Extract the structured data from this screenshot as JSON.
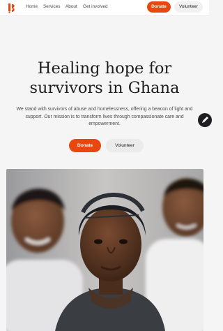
{
  "header": {
    "logo_icon": "organization-logo-icon",
    "nav": [
      "Home",
      "Services",
      "About",
      "Get involved"
    ],
    "donate_label": "Donate",
    "volunteer_label": "Volunteer"
  },
  "hero": {
    "title_line1": "Healing hope for",
    "title_line2": "survivors in Ghana",
    "description": "We stand with survivors of abuse and homelessness, offering a beacon of light and support. Our mission is to transform lives through compassionate care and empowerment.",
    "donate_label": "Donate",
    "volunteer_label": "Volunteer"
  },
  "edit_icon": "pencil-icon",
  "photo_icon": "hero-photo-children",
  "colors": {
    "accent": "#e8470f",
    "background": "#f5f5f6"
  }
}
